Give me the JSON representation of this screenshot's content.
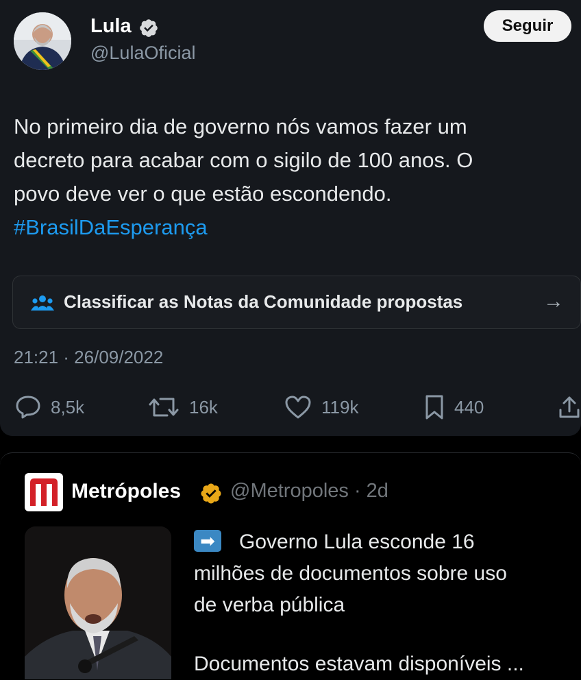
{
  "tweet": {
    "author_name": "Lula",
    "author_handle": "@LulaOficial",
    "follow_label": "Seguir",
    "text_line1": "No primeiro dia de governo nós vamos fazer um",
    "text_line2": "decreto para acabar com o sigilo de 100 anos. O",
    "text_line3": "povo deve ver o que estão escondendo.",
    "hashtag": "#BrasilDaEsperança",
    "community_notes_label": "Classificar as Notas da Comunidade propostas",
    "timestamp": "21:21 · 26/09/2022",
    "stats": {
      "replies": "8,5k",
      "retweets": "16k",
      "likes": "119k",
      "bookmarks": "440"
    }
  },
  "quoted": {
    "author_name": "Metrópoles",
    "author_handle": "@Metropoles · 2d",
    "text_line1": "Governo Lula esconde 16",
    "text_line2": "milhões de documentos sobre uso",
    "text_line3": "de verba pública",
    "text_line4": "Documentos estavam disponíveis ...",
    "arrow_emoji": "➡",
    "logo_letter": "m"
  },
  "colors": {
    "accent": "#1d9bf0",
    "verified_gold": "#e8a718",
    "card_bg": "#15181d"
  }
}
